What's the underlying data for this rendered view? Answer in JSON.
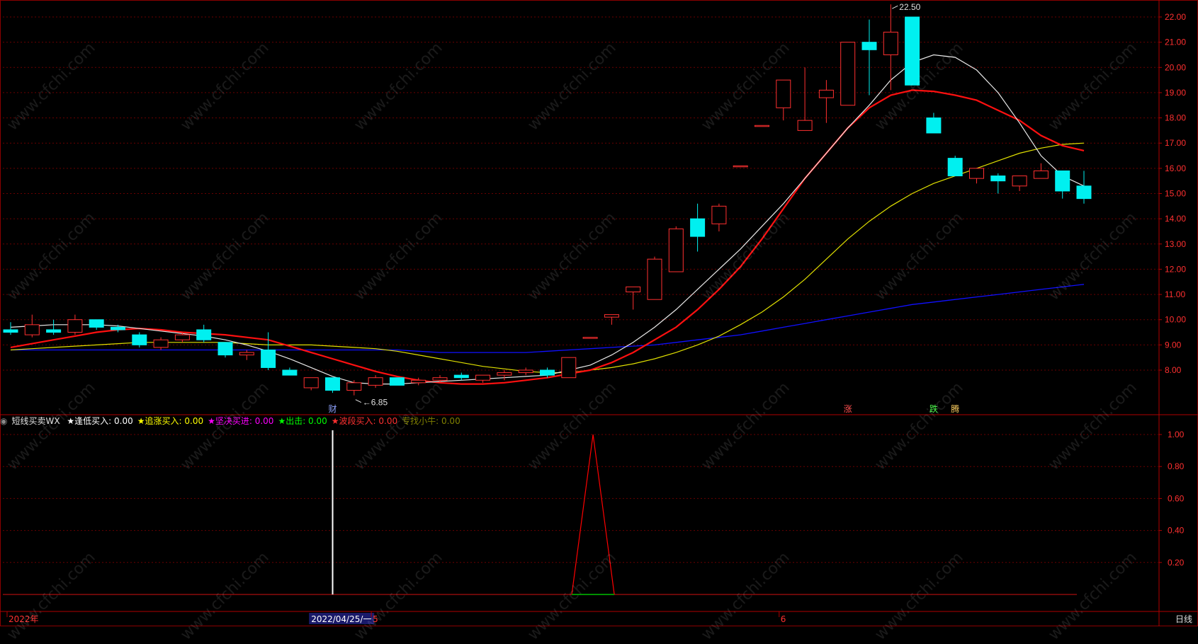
{
  "indicator": {
    "name": "短线买卖WX",
    "items": [
      {
        "label": "★逢低买入:",
        "value": "0.00",
        "color": "#ffffff"
      },
      {
        "label": "★追涨买入:",
        "value": "0.00",
        "color": "#ffff00"
      },
      {
        "label": "★坚决买进:",
        "value": "0.00",
        "color": "#ff00ff"
      },
      {
        "label": "★出击:",
        "value": "0.00",
        "color": "#00ff00"
      },
      {
        "label": "★波段买入:",
        "value": "0.00",
        "color": "#ff3030"
      },
      {
        "label": "专找小牛:",
        "value": "0.00",
        "color": "#808000"
      }
    ]
  },
  "period_button": "日线",
  "watermark": "www.cfchi.com",
  "chart_data": [
    {
      "type": "candlestick",
      "price_axis": {
        "min": 7.0,
        "max": 22.5,
        "ticks": [
          "8.00",
          "9.00",
          "10.00",
          "11.00",
          "12.00",
          "13.00",
          "14.00",
          "15.00",
          "16.00",
          "17.00",
          "18.00",
          "19.00",
          "20.00",
          "21.00",
          "22.00"
        ]
      },
      "max_label": "22.50",
      "min_label": "6.85",
      "candles": [
        {
          "o": 9.6,
          "h": 9.9,
          "l": 9.4,
          "c": 9.5
        },
        {
          "o": 9.4,
          "h": 10.2,
          "l": 9.3,
          "c": 9.8
        },
        {
          "o": 9.6,
          "h": 10.0,
          "l": 9.4,
          "c": 9.5
        },
        {
          "o": 9.5,
          "h": 10.2,
          "l": 9.4,
          "c": 10.0
        },
        {
          "o": 10.0,
          "h": 10.0,
          "l": 9.6,
          "c": 9.7
        },
        {
          "o": 9.7,
          "h": 9.8,
          "l": 9.5,
          "c": 9.6
        },
        {
          "o": 9.4,
          "h": 9.5,
          "l": 8.9,
          "c": 9.0
        },
        {
          "o": 8.9,
          "h": 9.3,
          "l": 8.8,
          "c": 9.2
        },
        {
          "o": 9.2,
          "h": 9.5,
          "l": 9.1,
          "c": 9.4
        },
        {
          "o": 9.6,
          "h": 9.8,
          "l": 9.1,
          "c": 9.2
        },
        {
          "o": 9.1,
          "h": 9.1,
          "l": 8.5,
          "c": 8.6
        },
        {
          "o": 8.6,
          "h": 8.8,
          "l": 8.4,
          "c": 8.7
        },
        {
          "o": 8.8,
          "h": 9.5,
          "l": 8.0,
          "c": 8.1
        },
        {
          "o": 8.0,
          "h": 8.1,
          "l": 7.8,
          "c": 7.8
        },
        {
          "o": 7.3,
          "h": 7.7,
          "l": 7.2,
          "c": 7.7
        },
        {
          "o": 7.7,
          "h": 7.7,
          "l": 7.1,
          "c": 7.2
        },
        {
          "o": 7.2,
          "h": 7.6,
          "l": 7.0,
          "c": 7.5
        },
        {
          "o": 7.4,
          "h": 7.8,
          "l": 7.3,
          "c": 7.7
        },
        {
          "o": 7.7,
          "h": 7.7,
          "l": 7.4,
          "c": 7.4
        },
        {
          "o": 7.5,
          "h": 7.7,
          "l": 7.4,
          "c": 7.6
        },
        {
          "o": 7.6,
          "h": 7.8,
          "l": 7.5,
          "c": 7.7
        },
        {
          "o": 7.8,
          "h": 7.9,
          "l": 7.6,
          "c": 7.7
        },
        {
          "o": 7.6,
          "h": 7.8,
          "l": 7.5,
          "c": 7.8
        },
        {
          "o": 7.8,
          "h": 8.0,
          "l": 7.6,
          "c": 7.9
        },
        {
          "o": 7.9,
          "h": 8.1,
          "l": 7.8,
          "c": 8.0
        },
        {
          "o": 8.0,
          "h": 8.1,
          "l": 7.7,
          "c": 7.8
        },
        {
          "o": 7.7,
          "h": 8.5,
          "l": 7.7,
          "c": 8.5
        },
        {
          "o": 9.3,
          "h": 9.3,
          "l": 9.3,
          "c": 9.3
        },
        {
          "o": 10.1,
          "h": 10.2,
          "l": 9.8,
          "c": 10.2
        },
        {
          "o": 11.1,
          "h": 11.3,
          "l": 10.4,
          "c": 11.3
        },
        {
          "o": 10.8,
          "h": 12.5,
          "l": 10.8,
          "c": 12.4
        },
        {
          "o": 11.9,
          "h": 13.7,
          "l": 11.9,
          "c": 13.6
        },
        {
          "o": 14.0,
          "h": 14.6,
          "l": 12.7,
          "c": 13.3
        },
        {
          "o": 13.8,
          "h": 14.6,
          "l": 13.5,
          "c": 14.5
        },
        {
          "o": 16.1,
          "h": 16.1,
          "l": 16.1,
          "c": 16.1
        },
        {
          "o": 17.7,
          "h": 17.7,
          "l": 17.7,
          "c": 17.7
        },
        {
          "o": 18.4,
          "h": 19.5,
          "l": 17.9,
          "c": 19.5
        },
        {
          "o": 17.5,
          "h": 20.0,
          "l": 17.5,
          "c": 17.9
        },
        {
          "o": 18.8,
          "h": 19.5,
          "l": 17.8,
          "c": 19.1
        },
        {
          "o": 18.5,
          "h": 21.0,
          "l": 18.5,
          "c": 21.0
        },
        {
          "o": 21.0,
          "h": 21.9,
          "l": 18.9,
          "c": 20.7
        },
        {
          "o": 20.5,
          "h": 22.5,
          "l": 19.1,
          "c": 21.4
        },
        {
          "o": 22.0,
          "h": 22.0,
          "l": 19.3,
          "c": 19.3
        },
        {
          "o": 18.0,
          "h": 18.2,
          "l": 17.4,
          "c": 17.4
        },
        {
          "o": 16.4,
          "h": 16.5,
          "l": 15.7,
          "c": 15.7
        },
        {
          "o": 15.6,
          "h": 16.0,
          "l": 15.4,
          "c": 16.0
        },
        {
          "o": 15.7,
          "h": 15.8,
          "l": 15.0,
          "c": 15.5
        },
        {
          "o": 15.3,
          "h": 15.7,
          "l": 15.1,
          "c": 15.7
        },
        {
          "o": 15.6,
          "h": 16.2,
          "l": 15.6,
          "c": 15.9
        },
        {
          "o": 15.9,
          "h": 15.9,
          "l": 14.8,
          "c": 15.1
        },
        {
          "o": 15.3,
          "h": 15.9,
          "l": 14.6,
          "c": 14.8
        }
      ],
      "ma_white": [
        9.7,
        9.75,
        9.8,
        9.8,
        9.8,
        9.75,
        9.65,
        9.55,
        9.45,
        9.35,
        9.2,
        9.0,
        8.75,
        8.45,
        8.1,
        7.75,
        7.5,
        7.45,
        7.45,
        7.5,
        7.55,
        7.6,
        7.65,
        7.7,
        7.75,
        7.8,
        8.0,
        8.2,
        8.6,
        9.1,
        9.7,
        10.4,
        11.2,
        12.0,
        12.8,
        13.7,
        14.6,
        15.6,
        16.6,
        17.6,
        18.5,
        19.5,
        20.2,
        20.5,
        20.4,
        19.9,
        19.0,
        17.8,
        16.5,
        15.7,
        15.3
      ],
      "ma_red": [
        8.9,
        9.05,
        9.2,
        9.35,
        9.5,
        9.6,
        9.65,
        9.6,
        9.5,
        9.45,
        9.4,
        9.3,
        9.2,
        8.95,
        8.7,
        8.45,
        8.2,
        7.95,
        7.75,
        7.6,
        7.5,
        7.45,
        7.45,
        7.5,
        7.6,
        7.7,
        7.85,
        8.0,
        8.3,
        8.7,
        9.2,
        9.7,
        10.4,
        11.2,
        12.1,
        13.2,
        14.4,
        15.6,
        16.6,
        17.6,
        18.4,
        18.9,
        19.1,
        19.05,
        18.9,
        18.7,
        18.3,
        17.9,
        17.3,
        16.9,
        16.7
      ],
      "ma_yellow": [
        8.8,
        8.85,
        8.9,
        8.95,
        9.0,
        9.05,
        9.1,
        9.1,
        9.1,
        9.1,
        9.1,
        9.05,
        9.0,
        9.0,
        9.0,
        8.95,
        8.9,
        8.85,
        8.75,
        8.6,
        8.45,
        8.3,
        8.15,
        8.05,
        7.95,
        7.9,
        7.9,
        8.0,
        8.1,
        8.25,
        8.45,
        8.7,
        9.0,
        9.35,
        9.8,
        10.3,
        10.9,
        11.6,
        12.4,
        13.2,
        13.9,
        14.5,
        15.0,
        15.4,
        15.7,
        16.0,
        16.3,
        16.6,
        16.8,
        16.95,
        17.0
      ],
      "ma_blue": [
        8.8,
        8.8,
        8.8,
        8.8,
        8.8,
        8.8,
        8.8,
        8.8,
        8.8,
        8.8,
        8.8,
        8.8,
        8.8,
        8.8,
        8.8,
        8.8,
        8.8,
        8.8,
        8.8,
        8.75,
        8.7,
        8.7,
        8.7,
        8.7,
        8.7,
        8.75,
        8.8,
        8.85,
        8.9,
        8.95,
        9.0,
        9.1,
        9.2,
        9.3,
        9.4,
        9.55,
        9.7,
        9.85,
        10.0,
        10.15,
        10.3,
        10.45,
        10.6,
        10.7,
        10.8,
        10.9,
        11.0,
        11.1,
        11.2,
        11.3,
        11.4
      ],
      "markers": [
        {
          "text": "财",
          "index": 15,
          "color": "#8fa3ff"
        },
        {
          "text": "涨",
          "index": 39,
          "color": "#ff5050"
        },
        {
          "text": "跌",
          "index": 43,
          "color": "#50ff50"
        },
        {
          "text": "腾",
          "index": 44,
          "color": "#ffd060"
        }
      ]
    },
    {
      "type": "line",
      "y_axis": {
        "min": 0.0,
        "max": 1.0,
        "ticks": [
          "0.20",
          "0.40",
          "0.60",
          "0.80",
          "1.00"
        ]
      },
      "series": [
        {
          "color": "#ff0000",
          "spike_index": 27,
          "values_note": "",
          "value": 1.0
        }
      ],
      "white_bar_index": 15
    }
  ],
  "x_axis_labels": [
    {
      "text": "2022年",
      "index": 0
    },
    {
      "text": "2022/04/25/一",
      "index": 14,
      "highlight": true
    },
    {
      "text": "5",
      "index": 17
    },
    {
      "text": "6",
      "index": 36
    }
  ]
}
